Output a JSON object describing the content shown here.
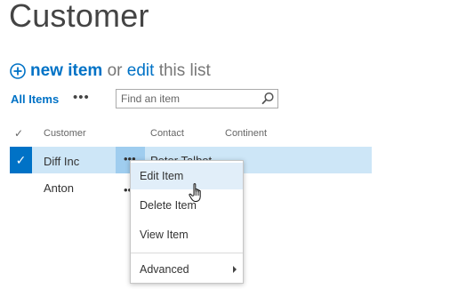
{
  "page": {
    "title": "Customer"
  },
  "command_bar": {
    "new_item_label": "new item",
    "or_label": "or",
    "edit_label": "edit",
    "this_list_label": "this list"
  },
  "views": {
    "current_view_label": "All Items",
    "more_ellipsis": "•••"
  },
  "search": {
    "placeholder": "Find an item",
    "value": ""
  },
  "table": {
    "check_glyph": "✓",
    "columns": [
      "Customer",
      "Contact",
      "Continent"
    ],
    "rows": [
      {
        "customer": "Diff Inc",
        "contact": "Peter Talbot",
        "continent": "",
        "selected": true
      },
      {
        "customer": "Anton",
        "contact": "",
        "continent": "",
        "selected": false
      }
    ],
    "row_ellipsis": "•••"
  },
  "context_menu": {
    "items": [
      "Edit Item",
      "Delete Item",
      "View Item"
    ],
    "advanced_label": "Advanced",
    "hovered_index": 0
  },
  "colors": {
    "accent": "#0072c6",
    "selected_row": "#cde6f7",
    "ellipsis_cell": "#9fcdef",
    "menu_hover": "#e1eef9"
  }
}
